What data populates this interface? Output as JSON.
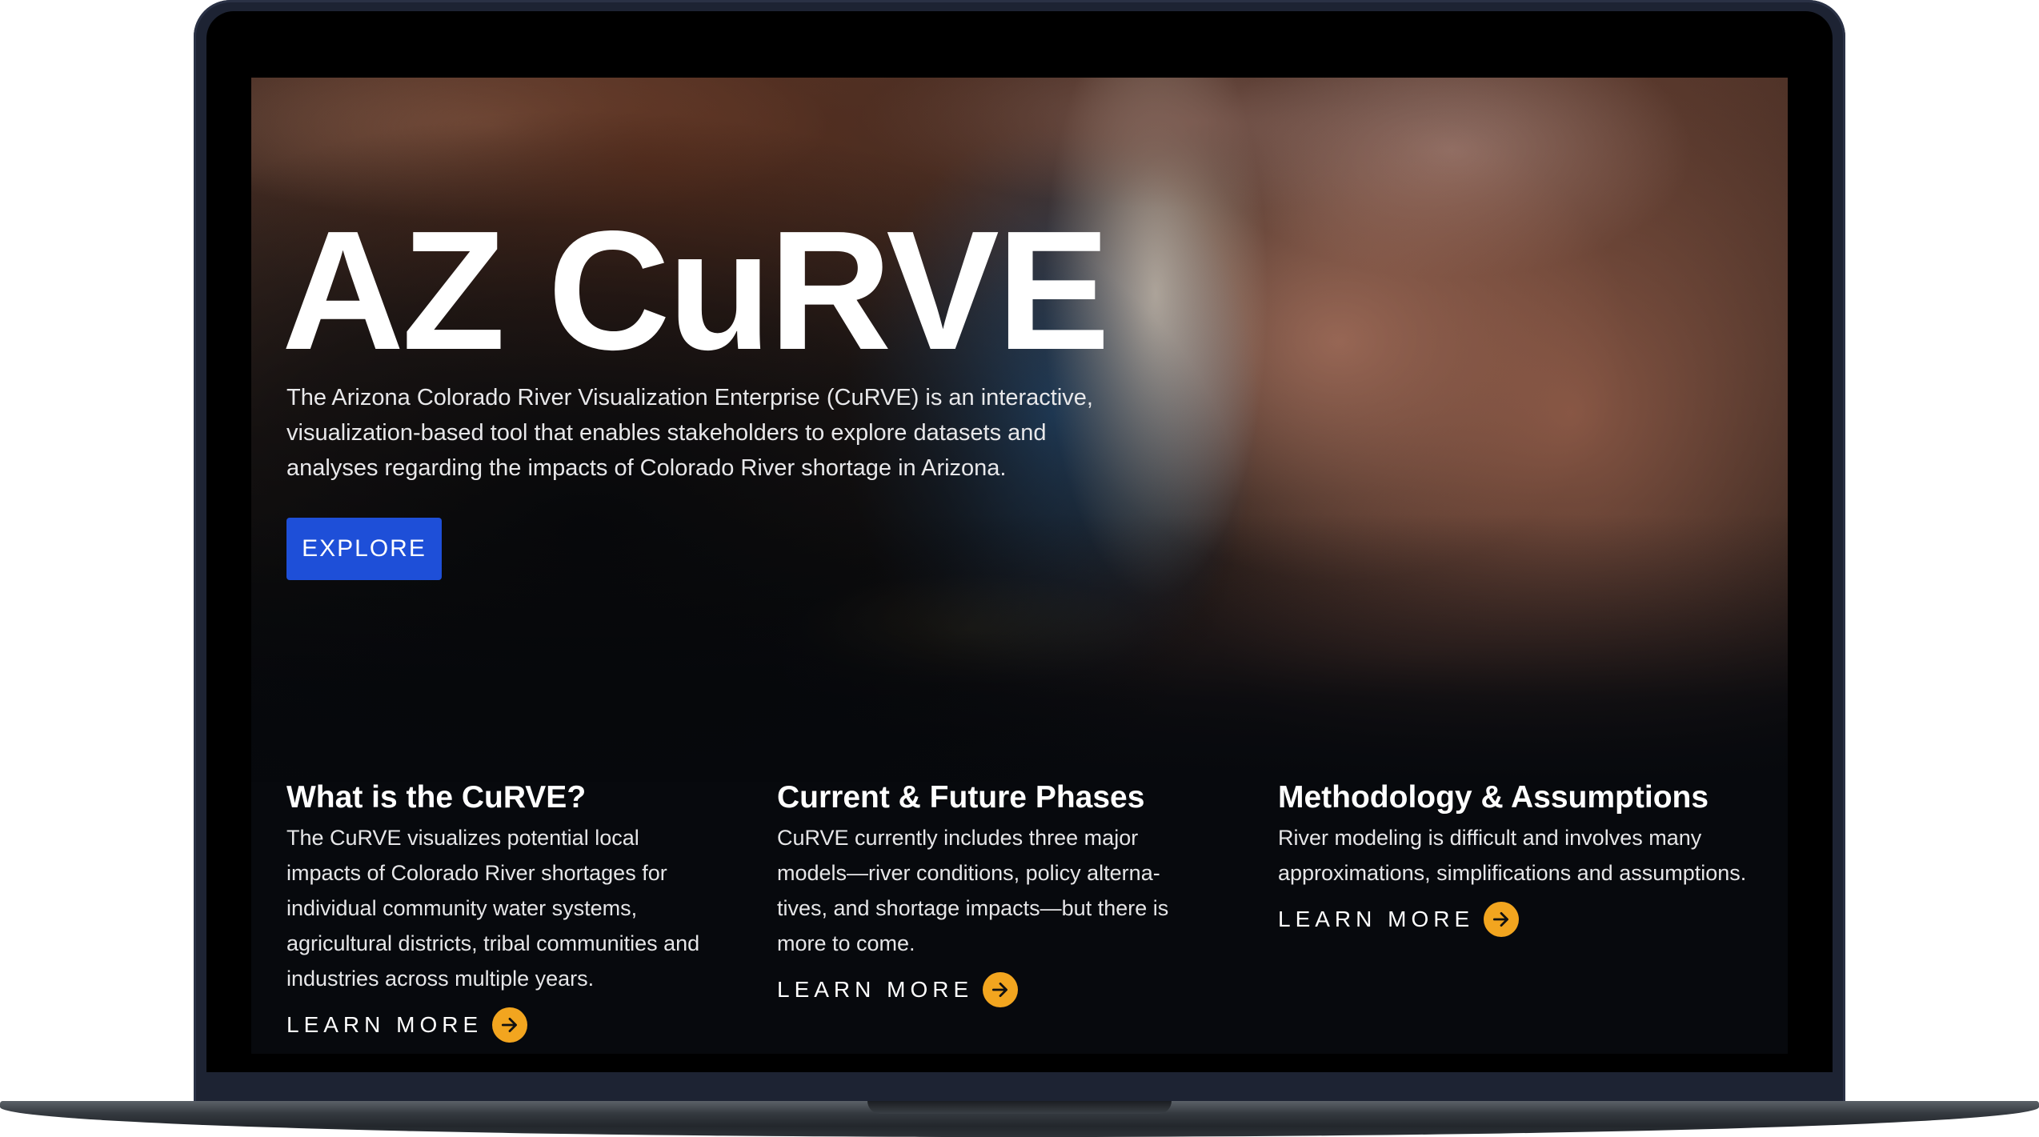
{
  "hero": {
    "title": "AZ CuRVE",
    "description": "The Arizona Colorado River Visualization Enterprise (CuRVE) is an interactive, visualization-based tool that enables stakeholders to explore datasets and analyses regarding the impacts of Colorado River shortage in Arizona.",
    "explore_label": "EXPLORE"
  },
  "sections": [
    {
      "title": "What is the CuRVE?",
      "body": "The CuRVE visualizes potential local impacts of Colorado River shortages for individual community water systems, agricultural districts, tribal communities and industries across multiple years.",
      "link_label": "LEARN MORE"
    },
    {
      "title": "Current & Future Phases",
      "body": "CuRVE currently includes three major models—river conditions, policy alterna-tives, and shortage impacts—but there is more to come.",
      "link_label": "LEARN MORE"
    },
    {
      "title": "Methodology & Assumptions",
      "body": "River modeling is difficult and involves many approximations, simplifications and assumptions.",
      "link_label": "LEARN MORE"
    }
  ],
  "colors": {
    "explore_button": "#1e4fd8",
    "accent_arrow": "#f2a51f",
    "page_background": "#07090d",
    "laptop_frame": "#1d2333"
  },
  "icons": {
    "learn_more": "arrow-right-icon"
  }
}
